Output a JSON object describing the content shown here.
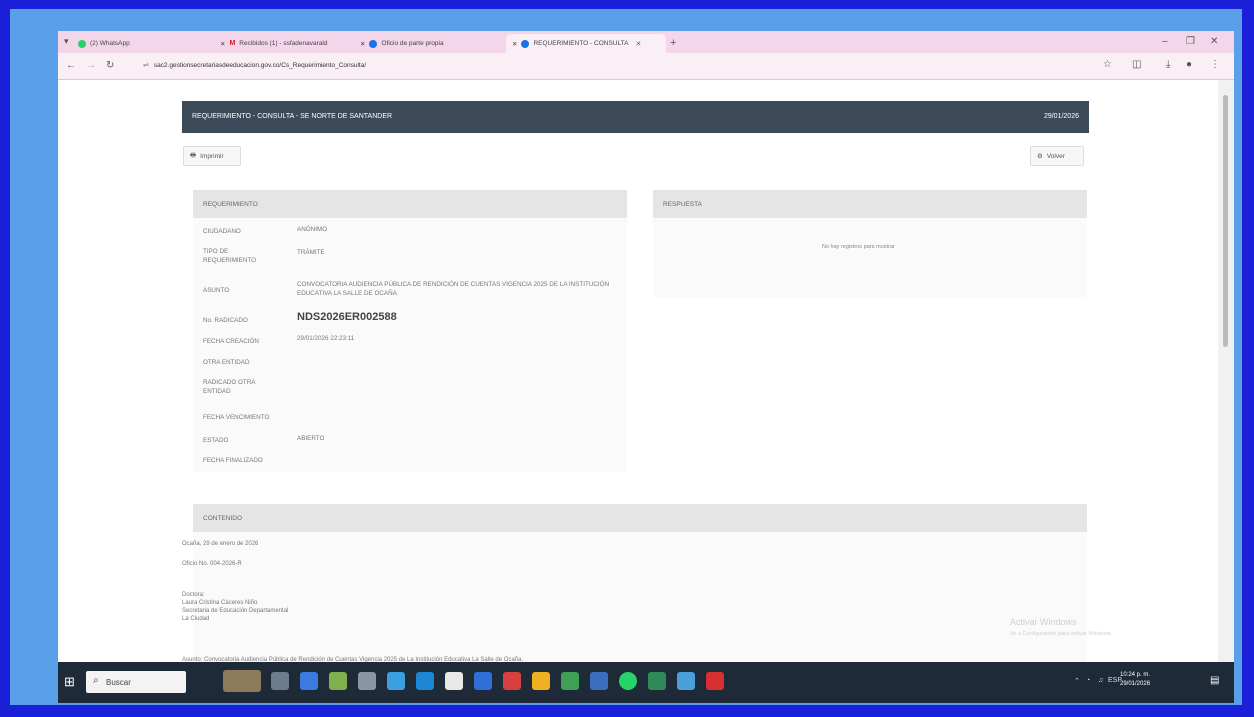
{
  "browser": {
    "tabs": [
      {
        "label": "(2) WhatsApp",
        "color": "#25d366"
      },
      {
        "label": "Recibidos (1) - ssfadenavarald",
        "color": "#c5221f"
      },
      {
        "label": "Oficio de parte propia",
        "color": "#1a73e8"
      },
      {
        "label": "REQUERIMIENTO - CONSULTA",
        "color": "#1a73e8"
      }
    ],
    "new_tab": "+",
    "url": "sac2.gestionsecretariasdeeducacion.gov.co/Cs_Requerimiento_Consulta/",
    "window_controls": [
      "–",
      "❐",
      "✕"
    ]
  },
  "header": {
    "title": "REQUERIMIENTO - CONSULTA - SE NORTE DE SANTANDER",
    "date": "29/01/2026"
  },
  "buttons": {
    "print": "Imprimir",
    "back": "Volver"
  },
  "requerimiento": {
    "title": "REQUERIMIENTO",
    "fields": [
      {
        "label": "CIUDADANO",
        "value": "ANÓNIMO"
      },
      {
        "label": "TIPO DE REQUERIMIENTO",
        "value": "TRÁMITE"
      },
      {
        "label": "ASUNTO",
        "value": "CONVOCATORIA AUDIENCIA PÚBLICA DE RENDICIÓN DE CUENTAS VIGENCIA 2025 DE LA INSTITUCIÓN EDUCATIVA LA SALLE DE OCAÑA"
      },
      {
        "label": "No. RADICADO",
        "value": "NDS2026ER002588"
      },
      {
        "label": "FECHA CREACIÓN",
        "value": "29/01/2026 22:23:11"
      },
      {
        "label": "OTRA ENTIDAD",
        "value": ""
      },
      {
        "label": "RADICADO OTRA ENTIDAD",
        "value": ""
      },
      {
        "label": "FECHA VENCIMIENTO",
        "value": ""
      },
      {
        "label": "ESTADO",
        "value": "ABIERTO"
      },
      {
        "label": "FECHA FINALIZADO",
        "value": ""
      }
    ]
  },
  "respuesta": {
    "title": "RESPUESTA",
    "empty": "No hay registros para mostrar"
  },
  "contenido": {
    "title": "CONTENIDO",
    "lines": [
      "Ocaña, 29 de enero de 2026",
      "Oficio No. 004-2026-R",
      "Doctora:",
      "Laura Cristina Cáceres Niño",
      "Secretaria de Educación Departamental",
      "La Ciudad",
      "Asunto: Convocatoria Audiencia Pública de Rendición de Cuentas Vigencia 2025 de La Institución Educativa La Salle de Ocaña."
    ]
  },
  "watermark": {
    "line1": "Activar Windows",
    "line2": "Ve a Configuración para activar Windows."
  },
  "taskbar": {
    "search": "Buscar",
    "clock_time": "10:24 p. m.",
    "clock_date": "29/01/2026",
    "lang": "ESP"
  }
}
